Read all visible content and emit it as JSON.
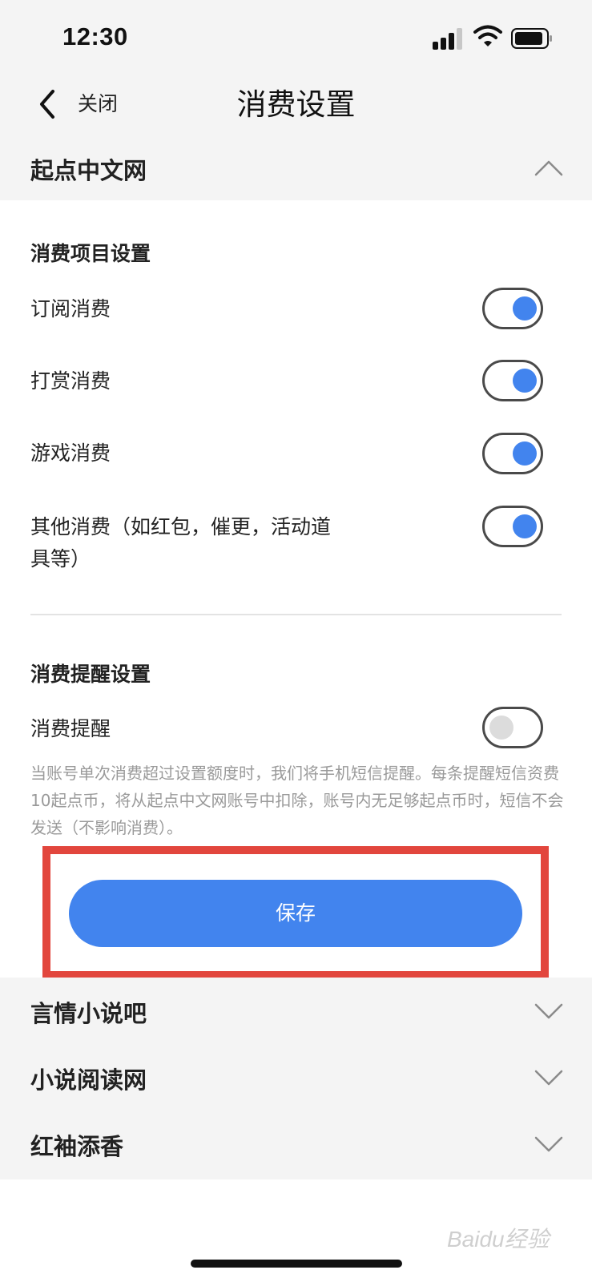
{
  "status_bar": {
    "time": "12:30"
  },
  "nav": {
    "close_label": "关闭",
    "title": "消费设置"
  },
  "sections": [
    {
      "title": "起点中文网",
      "expanded": true
    },
    {
      "title": "言情小说吧",
      "expanded": false
    },
    {
      "title": "小说阅读网",
      "expanded": false
    },
    {
      "title": "红袖添香",
      "expanded": false
    }
  ],
  "consumption_items": {
    "title": "消费项目设置",
    "items": [
      {
        "label": "订阅消费",
        "on": true
      },
      {
        "label": "打赏消费",
        "on": true
      },
      {
        "label": "游戏消费",
        "on": true
      },
      {
        "label": "其他消费（如红包，催更，活动道具等）",
        "on": true
      }
    ]
  },
  "reminder": {
    "title": "消费提醒设置",
    "label": "消费提醒",
    "on": false,
    "hint": "当账号单次消费超过设置额度时，我们将手机短信提醒。每条提醒短信资费10起点币，将从起点中文网账号中扣除，账号内无足够起点币时，短信不会发送（不影响消费）。"
  },
  "save_label": "保存",
  "watermark": "Baidu经验",
  "colors": {
    "accent": "#4284ee",
    "highlight": "#e2463d"
  }
}
